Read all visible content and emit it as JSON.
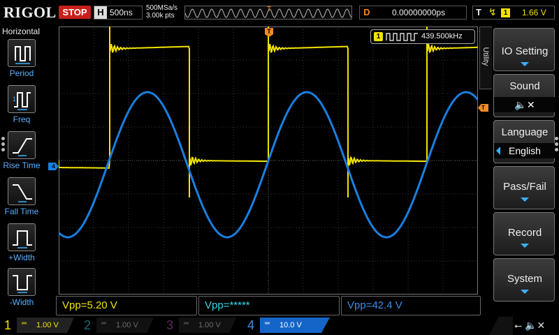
{
  "top": {
    "logo": "RIGOL",
    "run_status": "STOP",
    "horizontal_label": "H",
    "timebase": "500ns",
    "sample_rate": "500MSa/s",
    "memory_depth": "3.00k pts",
    "trigger_pos_label": "T",
    "delay_label": "D",
    "delay_value": "0.00000000ps",
    "trigger_label": "T",
    "trigger_edge_icon": "rising-edge-icon",
    "trigger_source": "1",
    "trigger_level": "1.66 V"
  },
  "left_toolbar": {
    "title": "Horizontal",
    "items": [
      {
        "label": "Period",
        "icon": "period-icon"
      },
      {
        "label": "Freq",
        "icon": "freq-icon"
      },
      {
        "label": "Rise Time",
        "icon": "rise-time-icon"
      },
      {
        "label": "Fall Time",
        "icon": "fall-time-icon"
      },
      {
        "label": "+Width",
        "icon": "pos-width-icon"
      },
      {
        "label": "-Width",
        "icon": "neg-width-icon"
      }
    ]
  },
  "screen": {
    "trigger_marker": "T",
    "ch4_marker": "4",
    "trigger_level_marker": "T",
    "freq_counter": {
      "channel": "1",
      "value": "439.500kHz"
    },
    "ch1_color": "#f2e400",
    "ch4_color": "#1a7fe0"
  },
  "measurements": [
    {
      "text": "Vpp=5.20 V",
      "color": "#f2e400"
    },
    {
      "text": "Vpp=*****",
      "color": "#35d6e8"
    },
    {
      "text": "Vpp=42.4 V",
      "color": "#3a8fe8"
    }
  ],
  "menu": {
    "tab": "Utility",
    "buttons": [
      {
        "label": "IO Setting",
        "value": null
      },
      {
        "label": "Sound",
        "value": "🔈✕"
      },
      {
        "label": "Language",
        "value": "English"
      },
      {
        "label": "Pass/Fail",
        "value": null
      },
      {
        "label": "Record",
        "value": null
      },
      {
        "label": "System",
        "value": null
      }
    ]
  },
  "channels": [
    {
      "num": "1",
      "coupling": "═",
      "scale": "1.00 V"
    },
    {
      "num": "2",
      "coupling": "═",
      "scale": "1.00 V"
    },
    {
      "num": "3",
      "coupling": "═",
      "scale": "1.00 V"
    },
    {
      "num": "4",
      "coupling": "═",
      "scale": "10.0 V"
    }
  ],
  "status_icons": "⭠ 🔈✕"
}
